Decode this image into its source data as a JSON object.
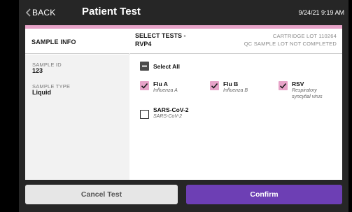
{
  "colors": {
    "accent_pink": "#e7a3c8",
    "primary_purple": "#6d3fb4",
    "background_dark": "#262626"
  },
  "header": {
    "back_label": "BACK",
    "back_icon": "chevron-left-icon",
    "title": "Patient Test",
    "datetime": "9/24/21 9:19 AM"
  },
  "sample_info": {
    "title": "SAMPLE INFO",
    "fields": [
      {
        "label": "SAMPLE ID",
        "value": "123"
      },
      {
        "label": "SAMPLE TYPE",
        "value": "Liquid"
      }
    ]
  },
  "select_tests": {
    "title_line1": "SELECT TESTS -",
    "title_line2": "RVP4",
    "cartridge_lot": "CARTRIDGE LOT  110264",
    "qc_status": "QC SAMPLE LOT  NOT COMPLETED",
    "select_all": {
      "label": "Select All",
      "state": "indeterminate"
    },
    "tests": [
      {
        "name": "Flu A",
        "description": "Influenza A",
        "checked": true
      },
      {
        "name": "Flu B",
        "description": "Influenza B",
        "checked": true
      },
      {
        "name": "RSV",
        "description_line1": "Respiratory",
        "description_line2": "syncytial virus",
        "checked": true
      },
      {
        "name": "SARS-CoV-2",
        "description": "SARS-CoV-2",
        "checked": false
      }
    ]
  },
  "footer": {
    "cancel_label": "Cancel Test",
    "confirm_label": "Confirm"
  }
}
